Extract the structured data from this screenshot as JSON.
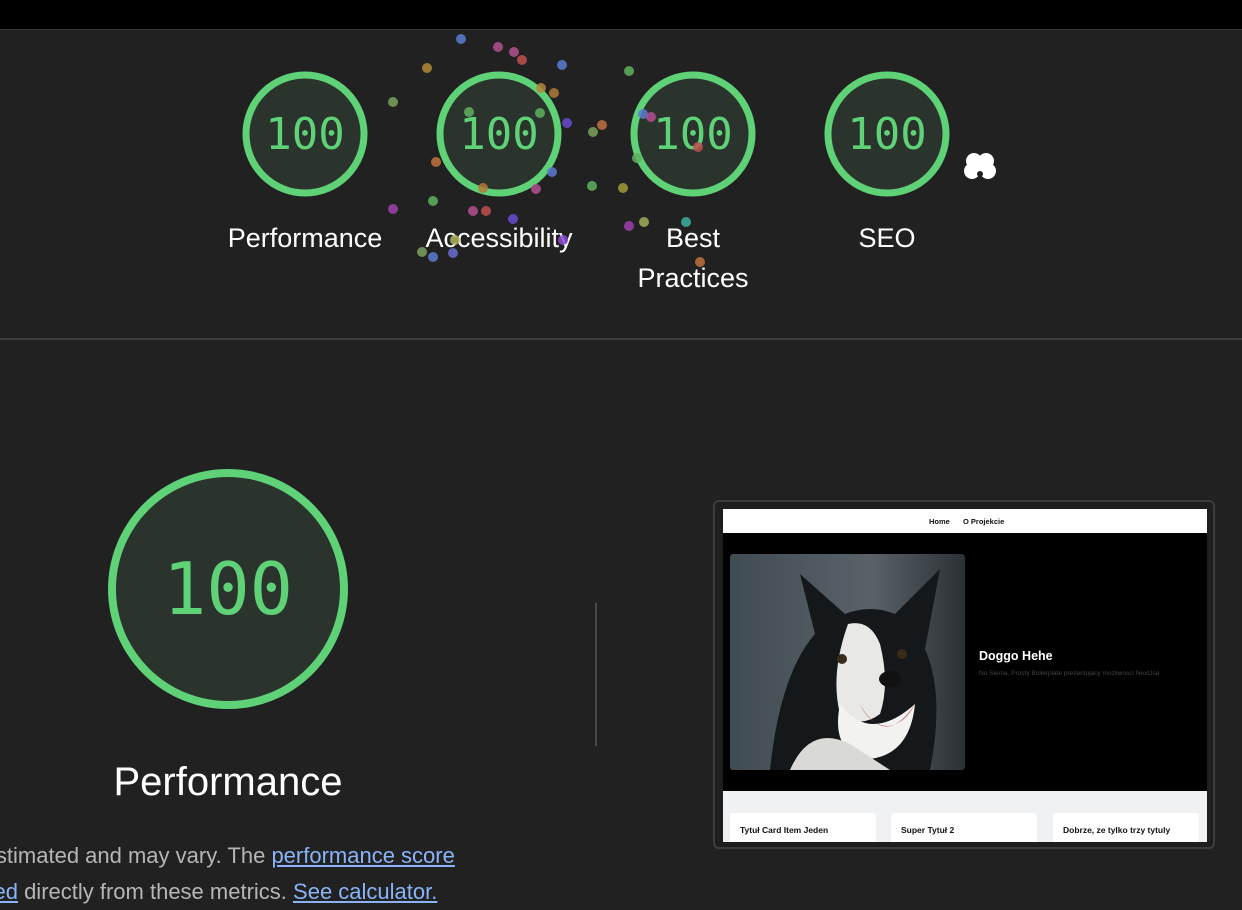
{
  "scores": [
    {
      "label": "Performance",
      "value": "100"
    },
    {
      "label": "Accessibility",
      "value": "100"
    },
    {
      "label": "Best Practices",
      "value": "100"
    },
    {
      "label": "SEO",
      "value": "100"
    }
  ],
  "detail": {
    "score": "100",
    "title": "Performance",
    "desc_text_1": "re estimated and may vary. The ",
    "desc_link_1": "performance score",
    "desc_text_2_link": "ulated",
    "desc_text_2": " directly from these metrics. ",
    "desc_link_2": "See calculator."
  },
  "preview": {
    "nav_home": "Home",
    "nav_about": "O Projekcie",
    "hero_title": "Doggo Hehe",
    "hero_subtitle": "No Siema, Prosty Boilerplate prezentujacy mozliwosci NextJsa",
    "cards": [
      "Tytuł Card Item Jeden",
      "Super Tytuł 2",
      "Dobrze, ze tylko trzy tytuly"
    ]
  },
  "colors": {
    "pass": "#5fd177",
    "gauge_fill": "#2a332c",
    "background": "#212121"
  }
}
